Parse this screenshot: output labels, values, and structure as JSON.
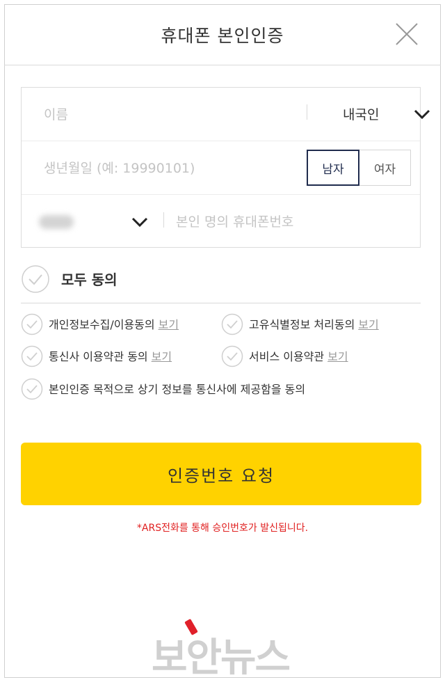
{
  "header": {
    "title": "휴대폰 본인인증"
  },
  "form": {
    "name_placeholder": "이름",
    "nationality": {
      "selected": "내국인"
    },
    "birth_placeholder": "생년월일 (예: 19990101)",
    "gender": {
      "male": "남자",
      "female": "여자",
      "selected": "남자"
    },
    "phone_placeholder": "본인 명의 휴대폰번호"
  },
  "agree": {
    "all_label": "모두 동의",
    "view_label": "보기",
    "items": [
      {
        "label": "개인정보수집/이용동의",
        "has_view": true
      },
      {
        "label": "고유식별정보 처리동의",
        "has_view": true
      },
      {
        "label": "통신사 이용약관 동의",
        "has_view": true
      },
      {
        "label": "서비스 이용약관",
        "has_view": true
      },
      {
        "label": "본인인증 목적으로 상기 정보를 통신사에 제공함을 동의",
        "has_view": false
      }
    ]
  },
  "submit_label": "인증번호 요청",
  "notice": "*ARS전화를 통해 승인번호가 발신됩니다.",
  "watermark": "보안뉴스",
  "colors": {
    "accent": "#ffd200",
    "notice": "#e02020",
    "selected_border": "#1f2b4d"
  }
}
